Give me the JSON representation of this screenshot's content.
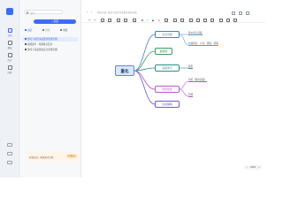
{
  "rail": {
    "items": [
      {
        "label": "文档",
        "icon": "document-icon"
      },
      {
        "label": "模板",
        "icon": "template-icon"
      },
      {
        "label": "历史",
        "icon": "history-icon"
      },
      {
        "label": "回收",
        "icon": "trash-icon"
      }
    ]
  },
  "panel": {
    "search_placeholder": "搜索",
    "new_button": "+ 新建",
    "tabs": [
      {
        "label": "最近"
      },
      {
        "label": "分享"
      },
      {
        "label": "收藏"
      }
    ],
    "docs": [
      {
        "label": "量化下软件深度量化思维导图"
      },
      {
        "label": "技能提升 - 专题集合目录"
      },
      {
        "label": "量化下深度量化完全思维导图"
      }
    ],
    "upgrade_text": "升级会员，解锁更多功能",
    "upgrade_button": "开通会员"
  },
  "topbar": {
    "breadcrumb": "我的文档 / 量化下软件深度量化思维导图"
  },
  "mindmap": {
    "root": "量化",
    "branches": [
      {
        "label": "交叉问题",
        "color": "#3b82c4",
        "leaves": [
          {
            "text": "量价因子选股",
            "color": "#5aa0d8"
          },
          {
            "text": "业绩预告、公告、研报、舆情",
            "color": "#5aa0d8"
          }
        ]
      },
      {
        "label": "数据库",
        "color": "#3aa057",
        "leaves": []
      },
      {
        "label": "深度学习",
        "color": "#2f8c8c",
        "leaves": [
          {
            "text": "模型",
            "color": "#2f8c8c"
          }
        ]
      },
      {
        "label": "风控优化",
        "color": "#b05cc8",
        "leaves": [
          {
            "text": "风控（量化选股）",
            "color": "#b05cc8"
          },
          {
            "text": "回测",
            "color": "#b05cc8"
          }
        ]
      },
      {
        "label": "交易策略",
        "color": "#6a5acd",
        "leaves": []
      }
    ]
  },
  "zoom": "100%"
}
